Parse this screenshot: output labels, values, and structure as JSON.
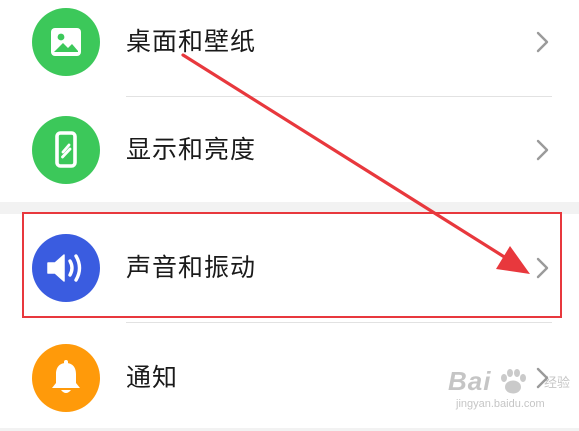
{
  "colors": {
    "wallpaper_icon_bg": "#3cc85a",
    "display_icon_bg": "#3cc85a",
    "sound_icon_bg": "#3a5ce0",
    "notify_icon_bg": "#ff9a0a",
    "annotation_red": "#e8383d",
    "chevron": "#9a9a9a"
  },
  "settings": {
    "items": [
      {
        "label": "桌面和壁纸",
        "icon": "image-icon"
      },
      {
        "label": "显示和亮度",
        "icon": "phone-icon"
      },
      {
        "label": "声音和振动",
        "icon": "speaker-icon"
      },
      {
        "label": "通知",
        "icon": "bell-icon"
      }
    ]
  },
  "annotation": {
    "highlighted_item": "声音和振动",
    "arrow_target": "chevron-right-icon"
  },
  "watermark": {
    "brand": "Bai",
    "brand_cn": "经验",
    "url": "jingyan.baidu.com"
  }
}
